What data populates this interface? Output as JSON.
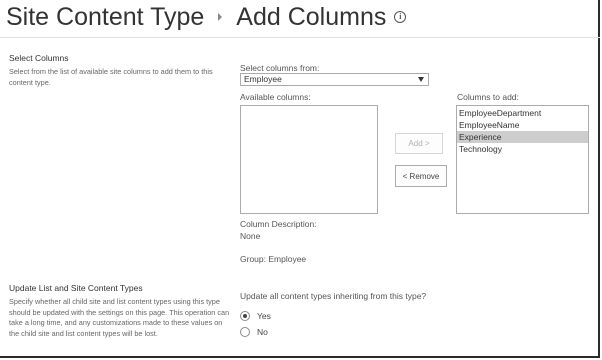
{
  "header": {
    "breadcrumb_parent": "Site Content Type",
    "page_title": "Add Columns",
    "info_glyph": "i"
  },
  "select_columns_section": {
    "title": "Select Columns",
    "description": "Select from the list of available site columns to add them to this content type.",
    "select_from_label": "Select columns from:",
    "select_from_value": "Employee",
    "available_label": "Available columns:",
    "available_items": [],
    "to_add_label": "Columns to add:",
    "to_add_items": [
      {
        "label": "EmployeeDepartment",
        "selected": false
      },
      {
        "label": "EmployeeName",
        "selected": false
      },
      {
        "label": "Experience",
        "selected": true
      },
      {
        "label": "Technology",
        "selected": false
      }
    ],
    "add_button": "Add >",
    "remove_button": "< Remove",
    "column_description_label": "Column Description:",
    "column_description_value": "None",
    "group_text": "Group: Employee"
  },
  "update_section": {
    "title": "Update List and Site Content Types",
    "description": "Specify whether all child site and list content types using this type should be updated with the settings on this page. This operation can take a long time, and any customizations made to these values on the child site and list content types will be lost.",
    "question": "Update all content types inheriting from this type?",
    "options": [
      {
        "label": "Yes",
        "checked": true
      },
      {
        "label": "No",
        "checked": false
      }
    ]
  }
}
